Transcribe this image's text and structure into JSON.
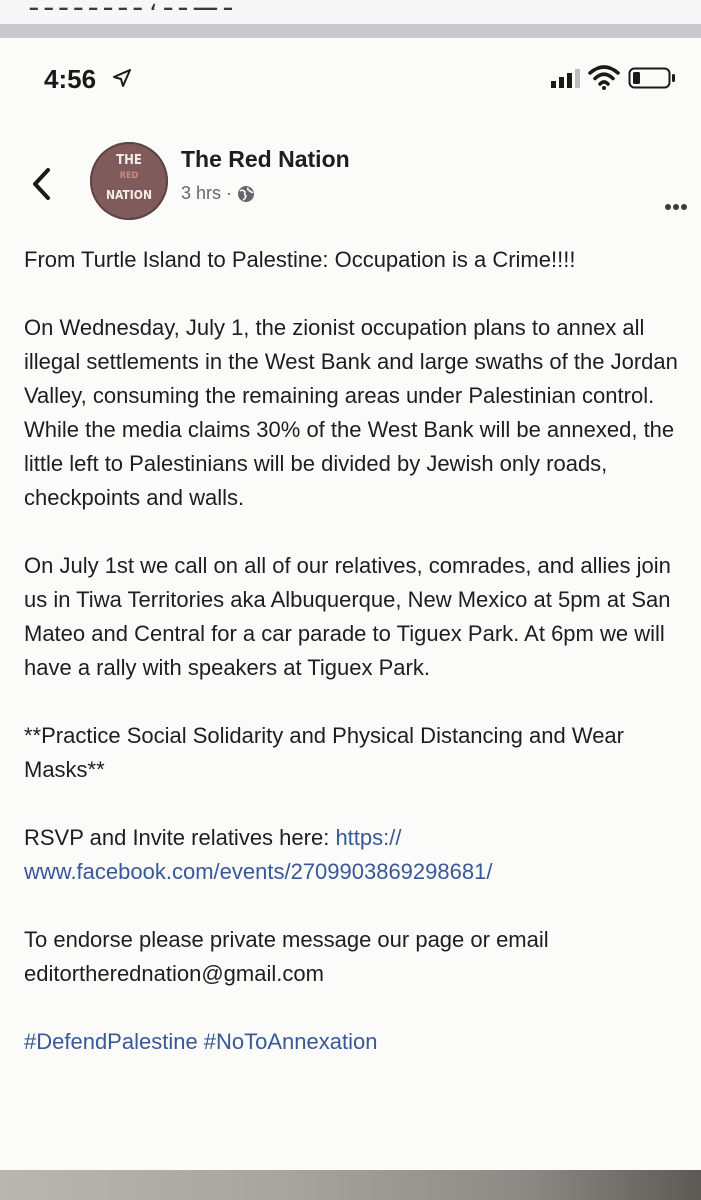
{
  "top_strip": {
    "cut_text": "ـ ـــ ـ ـ ، ـ ـ ـ ـ ـ ـ ـ ـ"
  },
  "status_bar": {
    "time": "4:56",
    "icons": [
      "location-arrow-icon",
      "cellular-signal-icon",
      "wifi-icon",
      "battery-icon"
    ]
  },
  "post": {
    "back_icon": "chevron-left-icon",
    "avatar_text": [
      "THE",
      "RED",
      "NATION"
    ],
    "page_name": "The Red Nation",
    "time_ago": "3 hrs",
    "separator": "·",
    "audience_icon": "globe-icon",
    "more_icon": "more-dots-icon",
    "paragraphs": [
      "From Turtle Island to Palestine: Occupation is a Crime!!!!",
      "On Wednesday, July 1, the zionist occupation plans to annex all illegal settlements in the West Bank and large swaths of the Jordan Valley, consuming the remaining areas under Palestinian control. While the media claims 30% of the West Bank will be annexed, the little left to Palestinians will be divided by Jewish only roads, checkpoints and walls.",
      "On July 1st we call on all of our relatives, comrades, and allies join us in Tiwa Territories aka Albuquerque, New Mexico at 5pm at San Mateo and Central for a car parade to Tiguex Park. At 6pm we will have a rally with speakers at Tiguex Park.",
      "**Practice Social Solidarity and Physical Distancing and Wear Masks**"
    ],
    "rsvp_prefix": "RSVP and Invite relatives here: ",
    "rsvp_link": "https:// www.facebook.com/events/2709903869298681/",
    "endorse_text": "To endorse please private message our page or email editortherednation@gmail.com",
    "hashtags": "#DefendPalestine #NoToAnnexation"
  },
  "colors": {
    "link": "#385898",
    "text": "#1c1e21",
    "meta": "#65676b",
    "avatar_bg": "#7f5b5b"
  }
}
